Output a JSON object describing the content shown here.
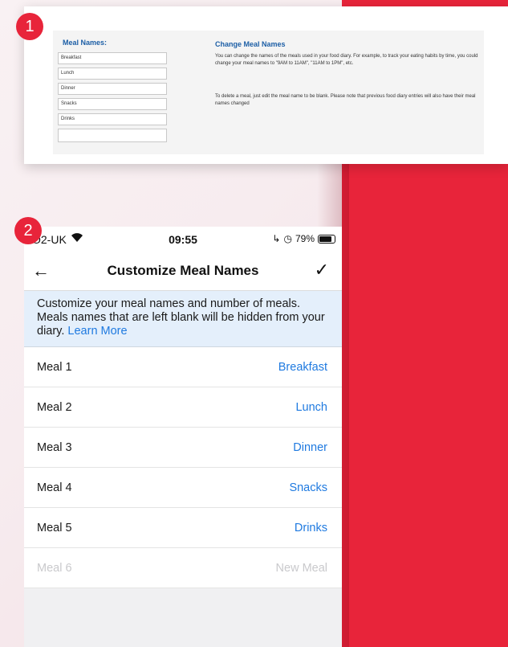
{
  "badges": {
    "one": "1",
    "two": "2"
  },
  "desktop": {
    "meal_names_heading": "Meal Names:",
    "fields": [
      "Breakfast",
      "Lunch",
      "Dinner",
      "Snacks",
      "Drinks",
      ""
    ],
    "change_heading": "Change Meal Names",
    "para1": "You can change the names of the meals used in your food diary. For example, to track your eating habits by time, you could change your meal names to \"9AM to 11AM\", \"11AM to 1PM\", etc.",
    "para2": "To delete a meal, just edit the meal name to be blank. Please note that previous food diary entries will also have their meal names changed"
  },
  "phone": {
    "status": {
      "carrier": "O2-UK",
      "time": "09:55",
      "battery": "79%"
    },
    "nav": {
      "title": "Customize Meal Names"
    },
    "info": {
      "text": "Customize your meal names and number of meals. Meals names that are left blank will be hidden from your diary.",
      "link": "Learn More"
    },
    "meals": [
      {
        "label": "Meal 1",
        "value": "Breakfast"
      },
      {
        "label": "Meal 2",
        "value": "Lunch"
      },
      {
        "label": "Meal 3",
        "value": "Dinner"
      },
      {
        "label": "Meal 4",
        "value": "Snacks"
      },
      {
        "label": "Meal 5",
        "value": "Drinks"
      },
      {
        "label": "Meal 6",
        "value": "New Meal"
      }
    ]
  },
  "colors": {
    "accent_red": "#e8243a",
    "link_blue": "#1f7ae0",
    "desktop_blue": "#1d5fa6"
  },
  "icons": [
    "wifi-icon",
    "back-arrow-icon",
    "checkmark-icon",
    "battery-icon",
    "location-icon",
    "alarm-icon"
  ]
}
